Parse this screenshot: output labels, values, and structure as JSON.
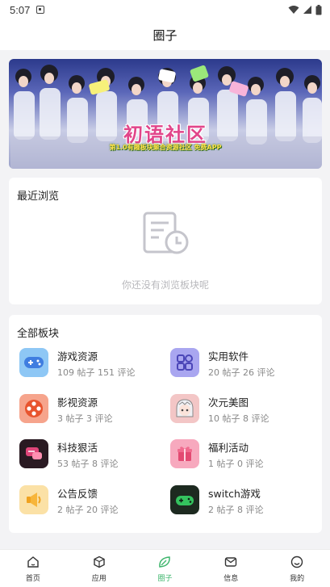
{
  "status_bar": {
    "time": "5:07"
  },
  "header": {
    "title": "圈子"
  },
  "banner": {
    "title": "初语社区",
    "subtitle": "第1.0有趣板块聚合资源社区 免费APP"
  },
  "recent": {
    "title": "最近浏览",
    "empty_text": "你还没有浏览板块呢"
  },
  "all_boards": {
    "title": "全部板块",
    "items": [
      {
        "name": "游戏资源",
        "stats": "109 帖子 151 评论",
        "icon": "gamepad-icon",
        "color": "#8ec7f5"
      },
      {
        "name": "实用软件",
        "stats": "20 帖子 26 评论",
        "icon": "apps-icon",
        "color": "#a9a6f0"
      },
      {
        "name": "影视资源",
        "stats": "3 帖子 3 评论",
        "icon": "film-reel-icon",
        "color": "#f6a48c"
      },
      {
        "name": "次元美图",
        "stats": "10 帖子 8 评论",
        "icon": "anime-avatar-icon",
        "color": "#f3c6c6"
      },
      {
        "name": "科技狠活",
        "stats": "53 帖子 8 评论",
        "icon": "tech-chat-icon",
        "color": "#2a1a22"
      },
      {
        "name": "福利活动",
        "stats": "1 帖子 0 评论",
        "icon": "gift-icon",
        "color": "#f7a9be"
      },
      {
        "name": "公告反馈",
        "stats": "2 帖子 20 评论",
        "icon": "megaphone-icon",
        "color": "#fbe1a6"
      },
      {
        "name": "switch游戏",
        "stats": "2 帖子 8 评论",
        "icon": "switch-controller-icon",
        "color": "#1d2a20"
      }
    ]
  },
  "tabbar": {
    "tabs": [
      {
        "label": "首页",
        "icon": "home-icon",
        "active": false
      },
      {
        "label": "应用",
        "icon": "cube-icon",
        "active": false
      },
      {
        "label": "圈子",
        "icon": "leaf-icon",
        "active": true
      },
      {
        "label": "信息",
        "icon": "mail-icon",
        "active": false
      },
      {
        "label": "我的",
        "icon": "smile-icon",
        "active": false
      }
    ]
  },
  "colors": {
    "accent": "#3cb56b",
    "banner_title": "#e1458a",
    "background": "#f3f3f5"
  }
}
